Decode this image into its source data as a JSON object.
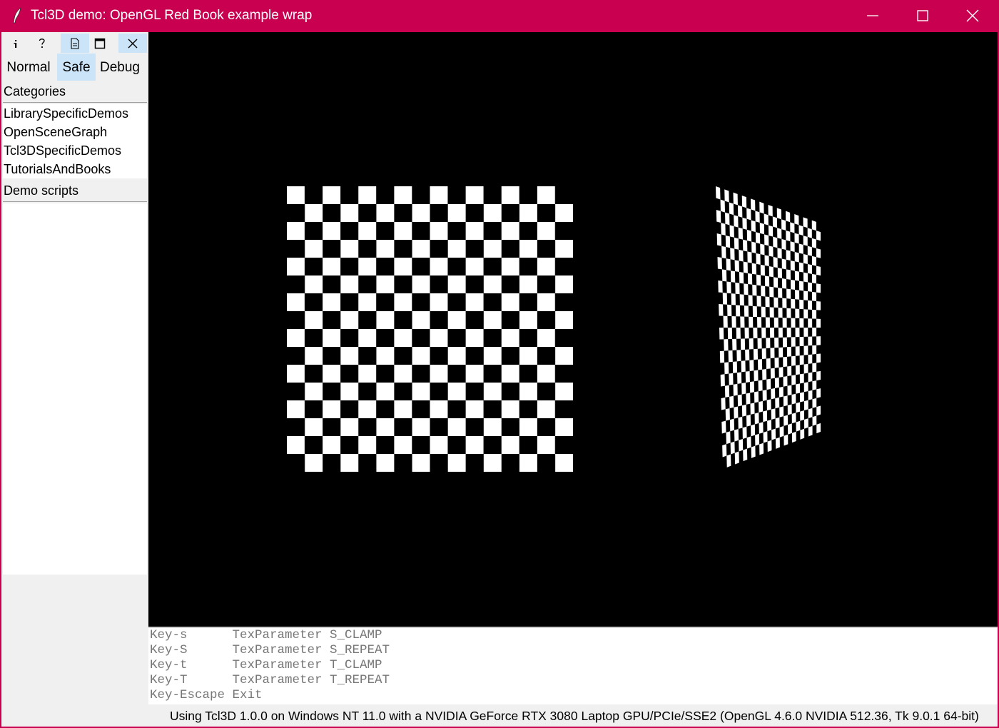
{
  "window": {
    "title": "Tcl3D demo: OpenGL Red Book example wrap",
    "accent_color": "#c8004f"
  },
  "toolbar": {
    "buttons": [
      {
        "icon": "info-icon",
        "glyph": "i"
      },
      {
        "icon": "help-icon",
        "glyph": "?"
      },
      {
        "icon": "document-icon",
        "glyph": ""
      },
      {
        "icon": "maximize-icon",
        "glyph": ""
      },
      {
        "icon": "close-icon",
        "glyph": ""
      }
    ]
  },
  "modes": {
    "normal": "Normal",
    "safe": "Safe",
    "debug": "Debug",
    "selected": "Safe"
  },
  "sidebar": {
    "categories_label": "Categories",
    "categories": [
      "LibrarySpecificDemos",
      "OpenSceneGraph",
      "Tcl3DSpecificDemos",
      "TutorialsAndBooks"
    ],
    "scripts_label": "Demo scripts"
  },
  "console": {
    "lines": [
      "Key-s      TexParameter S_CLAMP",
      "Key-S      TexParameter S_REPEAT",
      "Key-t      TexParameter T_CLAMP",
      "Key-T      TexParameter T_REPEAT",
      "Key-Escape Exit"
    ]
  },
  "status": {
    "text": "Using Tcl3D 1.0.0 on Windows NT 11.0 with a NVIDIA GeForce RTX 3080 Laptop GPU/PCIe/SSE2 (OpenGL 4.6.0 NVIDIA 512.36, Tk 9.0.1 64-bit)"
  }
}
